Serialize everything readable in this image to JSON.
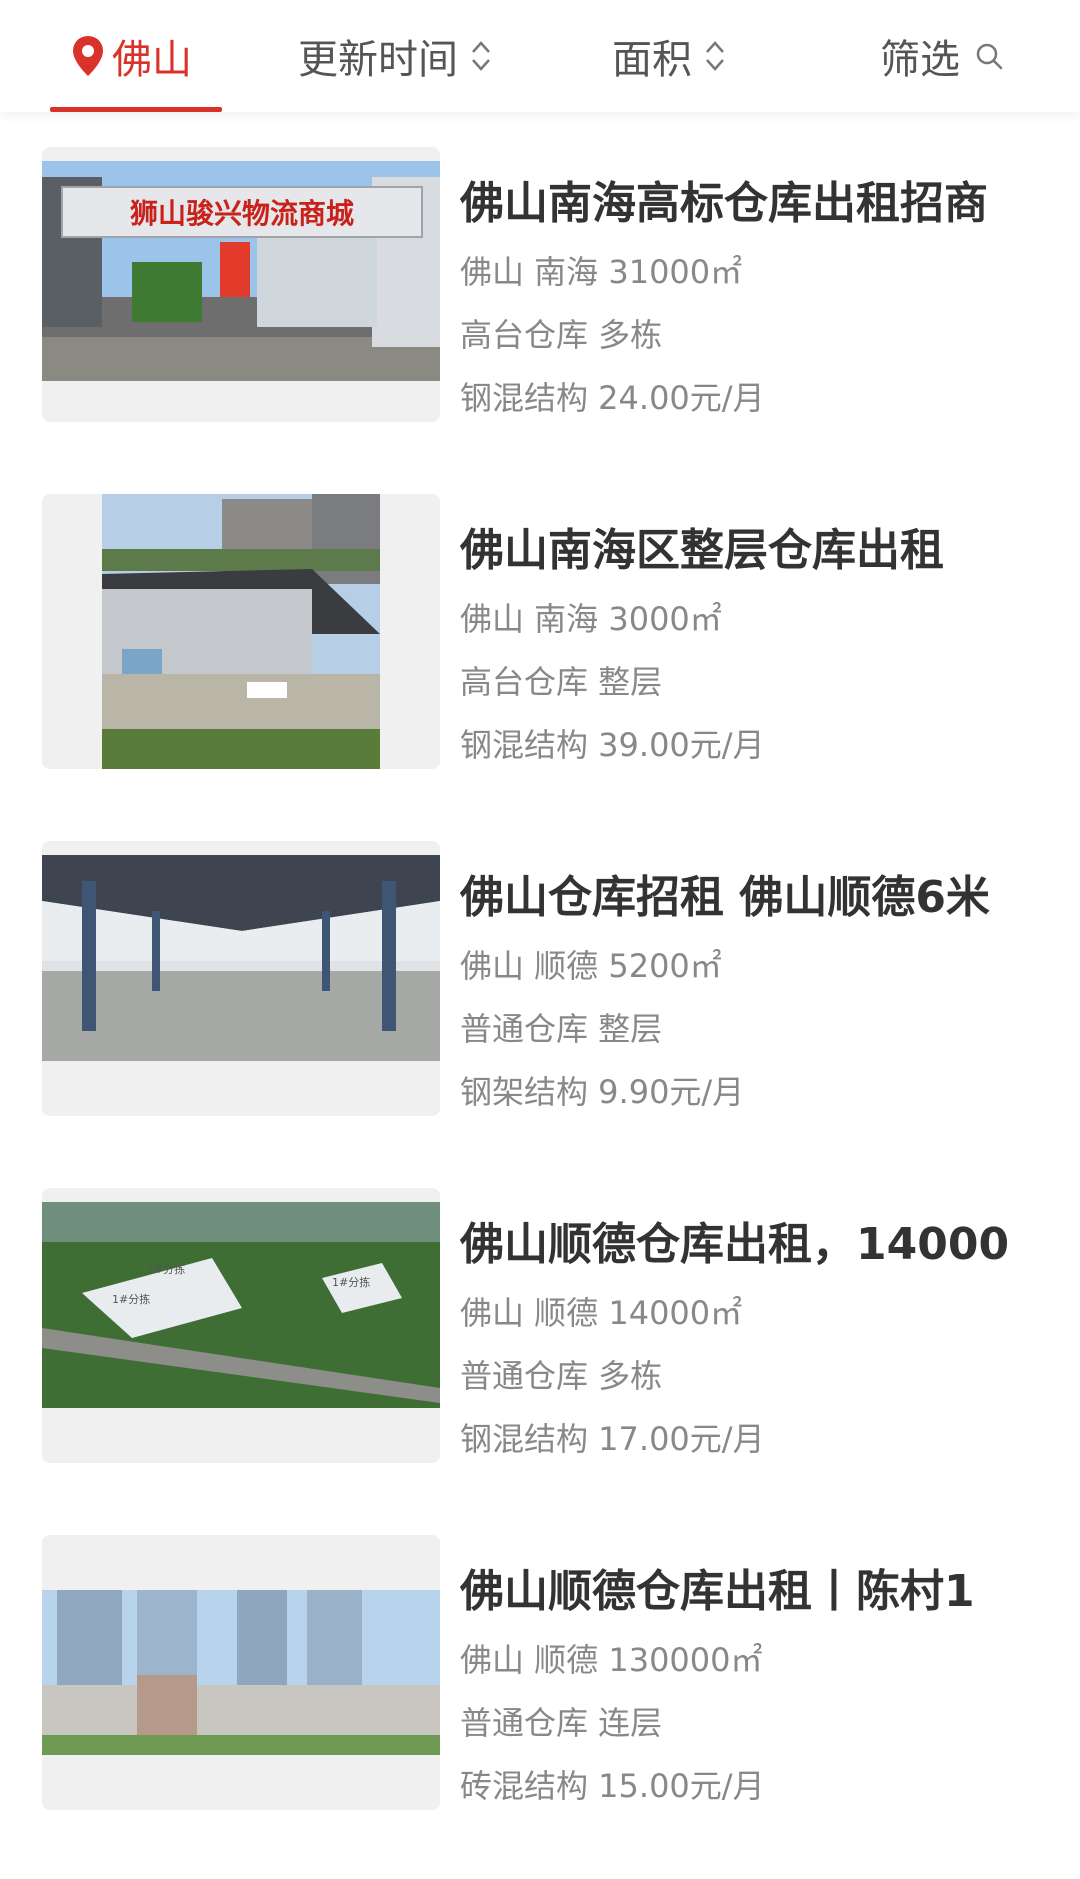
{
  "filter_bar": {
    "city": "佛山",
    "updated": "更新时间",
    "area": "面积",
    "filter": "筛选"
  },
  "listings": [
    {
      "title": "佛山南海高标仓库出租招商",
      "location": "佛山 南海 31000㎡",
      "type": "高台仓库 多栋",
      "price": "钢混结构 24.00元/月",
      "photo_sign": "狮山骏兴物流商城"
    },
    {
      "title": "佛山南海区整层仓库出租",
      "location": "佛山 南海 3000㎡",
      "type": "高台仓库 整层",
      "price": "钢混结构 39.00元/月"
    },
    {
      "title": "佛山仓库招租 佛山顺德6米",
      "location": "佛山 顺德 5200㎡",
      "type": "普通仓库 整层",
      "price": "钢架结构 9.90元/月"
    },
    {
      "title": "佛山顺德仓库出租，14000",
      "location": "佛山 顺德 14000㎡",
      "type": "普通仓库 多栋",
      "price": "钢混结构 17.00元/月",
      "photo_labels": [
        "1#分拣",
        "2#分拣",
        "1#分拣"
      ]
    },
    {
      "title": "佛山顺德仓库出租丨陈村1",
      "location": "佛山 顺德 130000㎡",
      "type": "普通仓库 连层",
      "price": "砖混结构 15.00元/月"
    }
  ]
}
